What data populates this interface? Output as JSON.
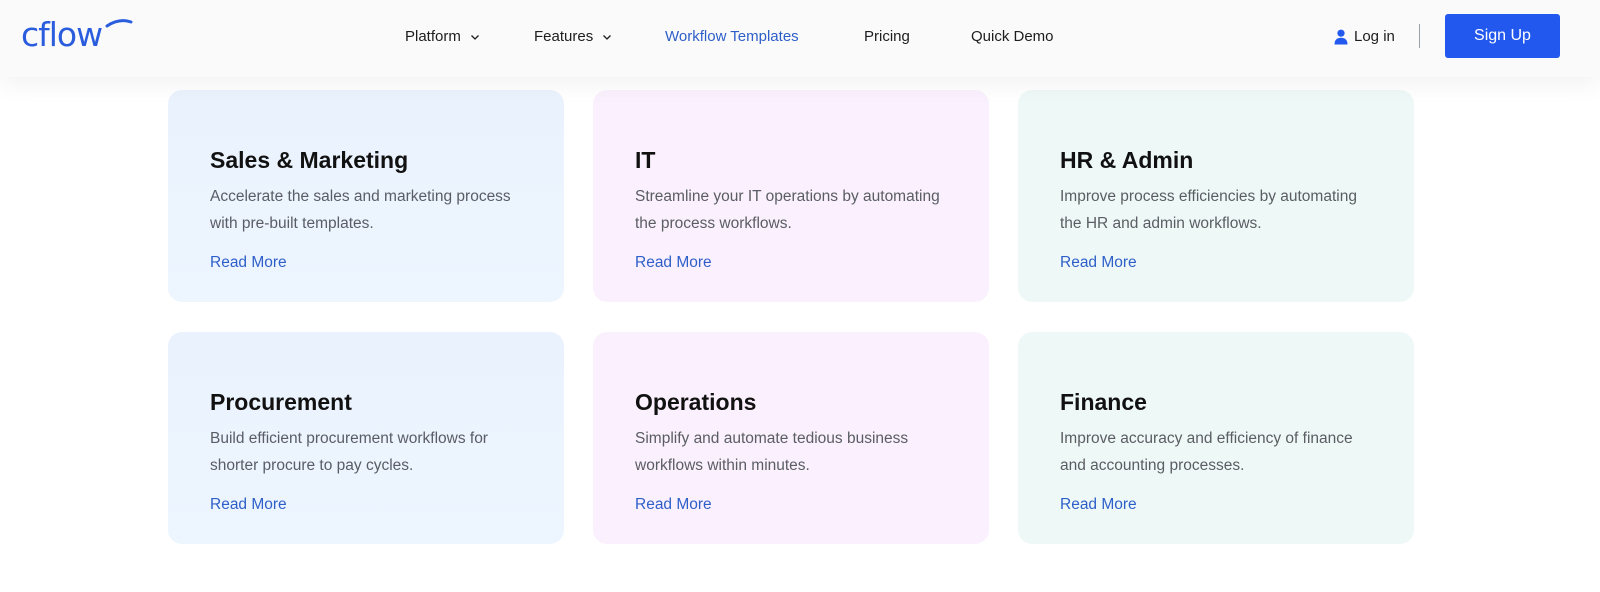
{
  "header": {
    "logo_text": "cflow",
    "nav": [
      {
        "label": "Platform",
        "has_dropdown": true
      },
      {
        "label": "Features",
        "has_dropdown": true
      },
      {
        "label": "Workflow Templates",
        "active": true
      },
      {
        "label": "Pricing"
      },
      {
        "label": "Quick Demo"
      }
    ],
    "login_label": "Log in",
    "signup_label": "Sign Up"
  },
  "cards": [
    {
      "title": "Sales & Marketing",
      "description": "Accelerate the sales and marketing process with pre-built templates.",
      "link": "Read More"
    },
    {
      "title": "IT",
      "description": "Streamline your IT operations by automating the process workflows.",
      "link": "Read More"
    },
    {
      "title": "HR & Admin",
      "description": "Improve process efficiencies by automating the HR and admin workflows.",
      "link": "Read More"
    },
    {
      "title": "Procurement",
      "description": "Build efficient procurement workflows for shorter procure to pay cycles.",
      "link": "Read More"
    },
    {
      "title": "Operations",
      "description": "Simplify and automate tedious business workflows within minutes.",
      "link": "Read More"
    },
    {
      "title": "Finance",
      "description": "Improve accuracy and efficiency of finance and accounting processes.",
      "link": "Read More"
    }
  ],
  "colors": {
    "accent": "#2358ef",
    "link": "#2e5fc9",
    "card_blue": "#edf5ff",
    "card_pink": "#fbf0fd",
    "card_green": "#eef9f7"
  },
  "icons": {
    "login": "user-icon",
    "dropdown": "chevron-down-icon"
  }
}
